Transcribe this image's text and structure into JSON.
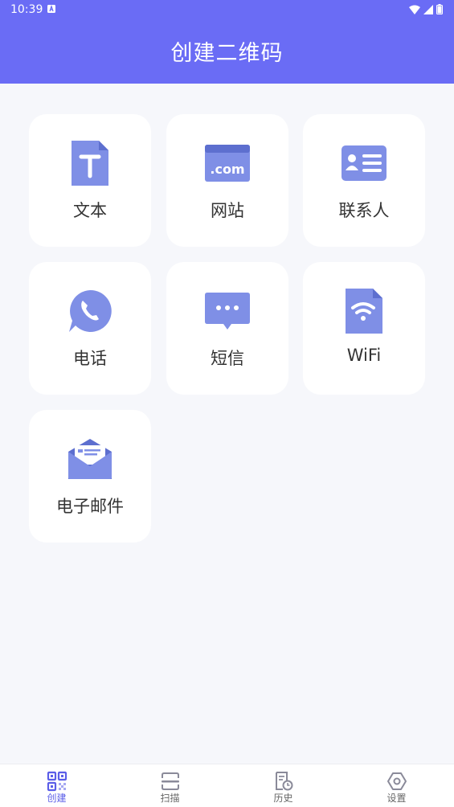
{
  "status": {
    "time": "10:39"
  },
  "header": {
    "title": "创建二维码"
  },
  "colors": {
    "accent": "#6a6cf5",
    "icon": "#7f8fe6",
    "icon_dark": "#5d6fcf"
  },
  "cards": [
    {
      "label": "文本",
      "icon": "text-file-icon"
    },
    {
      "label": "网站",
      "icon": "website-com-icon"
    },
    {
      "label": "联系人",
      "icon": "contact-card-icon"
    },
    {
      "label": "电话",
      "icon": "phone-icon"
    },
    {
      "label": "短信",
      "icon": "sms-bubble-icon"
    },
    {
      "label": "WiFi",
      "icon": "wifi-file-icon"
    },
    {
      "label": "电子邮件",
      "icon": "email-envelope-icon"
    }
  ],
  "nav": [
    {
      "label": "创建",
      "icon": "qr-create-icon",
      "active": true
    },
    {
      "label": "扫描",
      "icon": "scan-icon",
      "active": false
    },
    {
      "label": "历史",
      "icon": "history-icon",
      "active": false
    },
    {
      "label": "设置",
      "icon": "settings-icon",
      "active": false
    }
  ]
}
